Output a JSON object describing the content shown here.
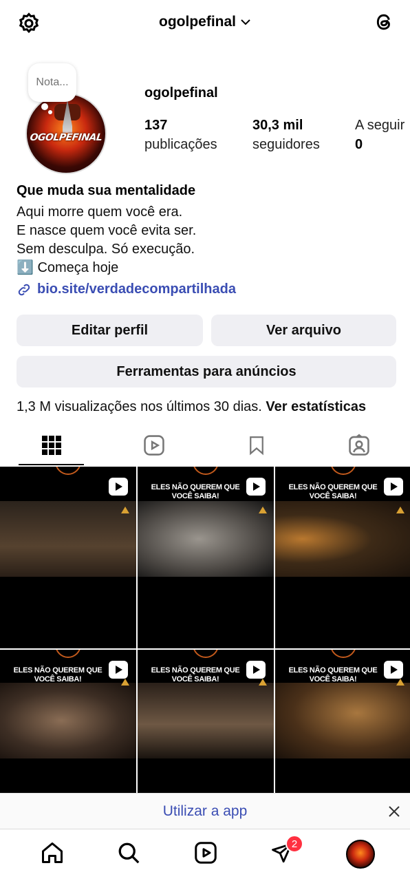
{
  "header": {
    "username": "ogolpefinal",
    "settings_icon": "settings-icon",
    "threads_icon": "threads-icon"
  },
  "note": {
    "placeholder": "Nota..."
  },
  "profile": {
    "avatar_logo_text": "OGOLPEFINAL",
    "username": "ogolpefinal",
    "stats": [
      {
        "value": "137",
        "label": "publicações"
      },
      {
        "value": "30,3 mil",
        "label": "seguidores"
      },
      {
        "value": "0",
        "label": "A seguir"
      }
    ]
  },
  "bio": {
    "name": "Que muda sua mentalidade",
    "lines": [
      "Aqui morre quem você era.",
      "E nasce quem você evita ser.",
      "Sem desculpa. Só execução.",
      "⬇️ Começa hoje"
    ],
    "link": "bio.site/verdadecompartilhada"
  },
  "buttons": {
    "edit_profile": "Editar perfil",
    "view_archive": "Ver arquivo",
    "ad_tools": "Ferramentas para anúncios"
  },
  "insights": {
    "text": "1,3 M visualizações nos últimos 30 dias.",
    "action": "Ver estatísticas"
  },
  "tabs": [
    {
      "name": "grid-icon",
      "active": true
    },
    {
      "name": "reels-icon",
      "active": false
    },
    {
      "name": "saved-icon",
      "active": false
    },
    {
      "name": "tagged-icon",
      "active": false
    }
  ],
  "posts": [
    {
      "caption": "",
      "subtitle": "",
      "scene_color": "#3b3128"
    },
    {
      "caption": "ELES NÃO QUEREM QUE VOCÊ SAIBA!",
      "subtitle": "",
      "scene_color": "#6a6560"
    },
    {
      "caption": "ELES NÃO QUEREM QUE VOCÊ SAIBA!",
      "subtitle": "",
      "scene_color": "#3a2715"
    },
    {
      "caption": "ELES NÃO QUEREM QUE VOCÊ SAIBA!",
      "subtitle": "",
      "scene_color": "#3d2e24"
    },
    {
      "caption": "ELES NÃO QUEREM QUE VOCÊ SAIBA!",
      "subtitle": "",
      "scene_color": "#4a3a2e"
    },
    {
      "caption": "ELES NÃO QUEREM QUE VOCÊ SAIBA!",
      "subtitle": "",
      "scene_color": "#5a3e22"
    }
  ],
  "app_banner": {
    "label": "Utilizar a app"
  },
  "bottom_nav": {
    "activity_badge": "2"
  }
}
